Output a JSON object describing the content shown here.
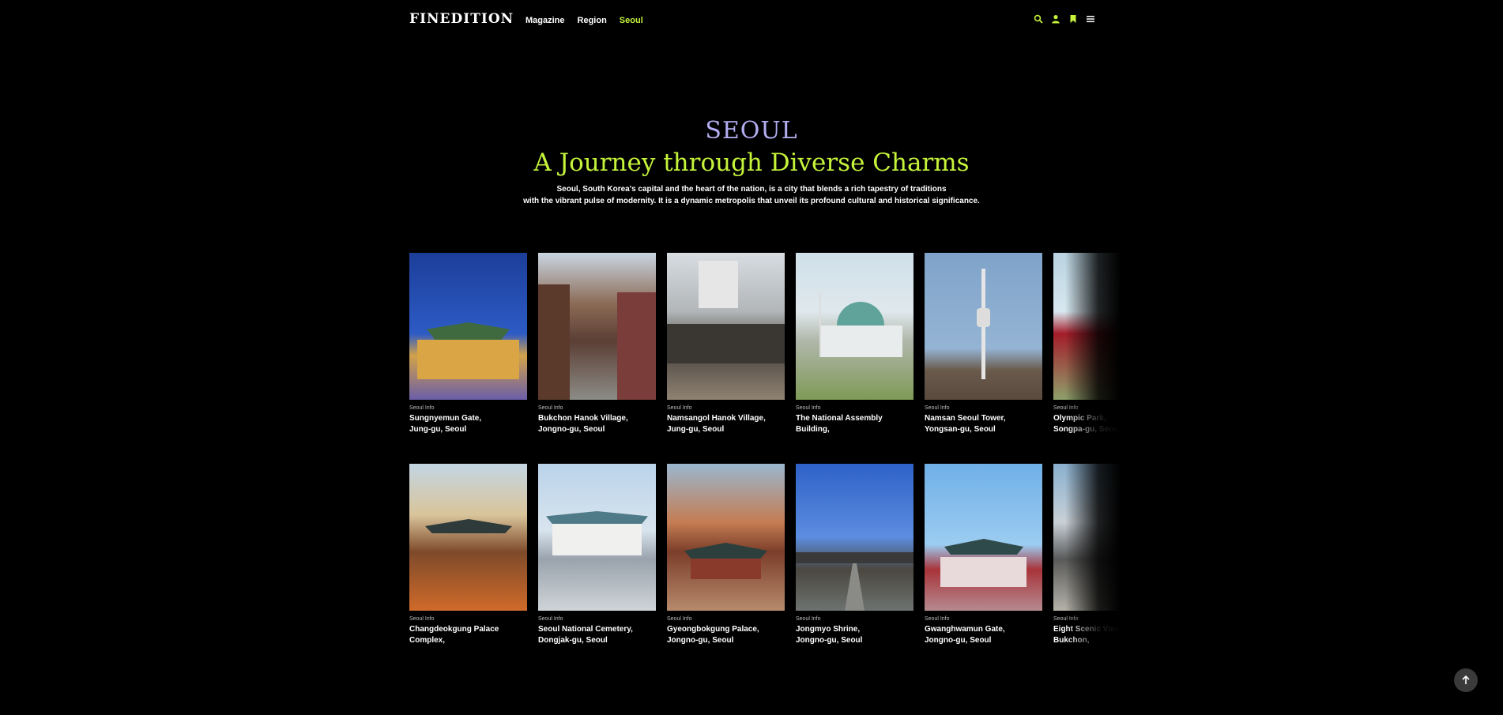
{
  "header": {
    "logo": "FINEDITION",
    "nav": [
      {
        "label": "Magazine"
      },
      {
        "label": "Region"
      },
      {
        "label": "Seoul",
        "active": true
      }
    ],
    "icons": [
      "search-icon",
      "user-icon",
      "bookmark-icon",
      "menu-icon"
    ],
    "accent": "#c6f43b"
  },
  "hero": {
    "city": "SEOUL",
    "headline": "A Journey through Diverse Charms",
    "desc_line1": "Seoul, South Korea's capital and the heart of the nation, is a city that blends a rich tapestry of traditions",
    "desc_line2": "with the vibrant pulse of modernity. It is a dynamic metropolis that unveil its profound cultural and historical significance.",
    "city_color": "#b3aef2"
  },
  "rows": [
    [
      {
        "category": "Seoul Info",
        "line1": "Sungnyemun Gate,",
        "line2": "Jung-gu,  Seoul"
      },
      {
        "category": "Seoul Info",
        "line1": "Bukchon Hanok Village,",
        "line2": "Jongno-gu,  Seoul"
      },
      {
        "category": "Seoul Info",
        "line1": "Namsangol Hanok Village,",
        "line2": "Jung-gu,  Seoul"
      },
      {
        "category": "Seoul Info",
        "line1": "The National Assembly",
        "line2": "Building,"
      },
      {
        "category": "Seoul Info",
        "line1": "Namsan Seoul Tower,",
        "line2": "Yongsan-gu,  Seoul"
      },
      {
        "category": "Seoul Info",
        "line1": "Olympic Park,",
        "line2": "Songpa-gu,  Seoul"
      }
    ],
    [
      {
        "category": "Seoul Info",
        "line1": "Changdeokgung Palace",
        "line2": "Complex,"
      },
      {
        "category": "Seoul Info",
        "line1": "Seoul National Cemetery,",
        "line2": "Dongjak-gu,  Seoul"
      },
      {
        "category": "Seoul Info",
        "line1": "Gyeongbokgung Palace,",
        "line2": "Jongno-gu,  Seoul"
      },
      {
        "category": "Seoul Info",
        "line1": "Jongmyo Shrine,",
        "line2": "Jongno-gu,  Seoul"
      },
      {
        "category": "Seoul Info",
        "line1": "Gwanghwamun Gate,",
        "line2": "Jongno-gu,  Seoul"
      },
      {
        "category": "Seoul Info",
        "line1": "Eight Scenic Views of",
        "line2": "Bukchon,"
      }
    ]
  ],
  "back_to_top": {
    "icon": "arrow-up-icon"
  }
}
